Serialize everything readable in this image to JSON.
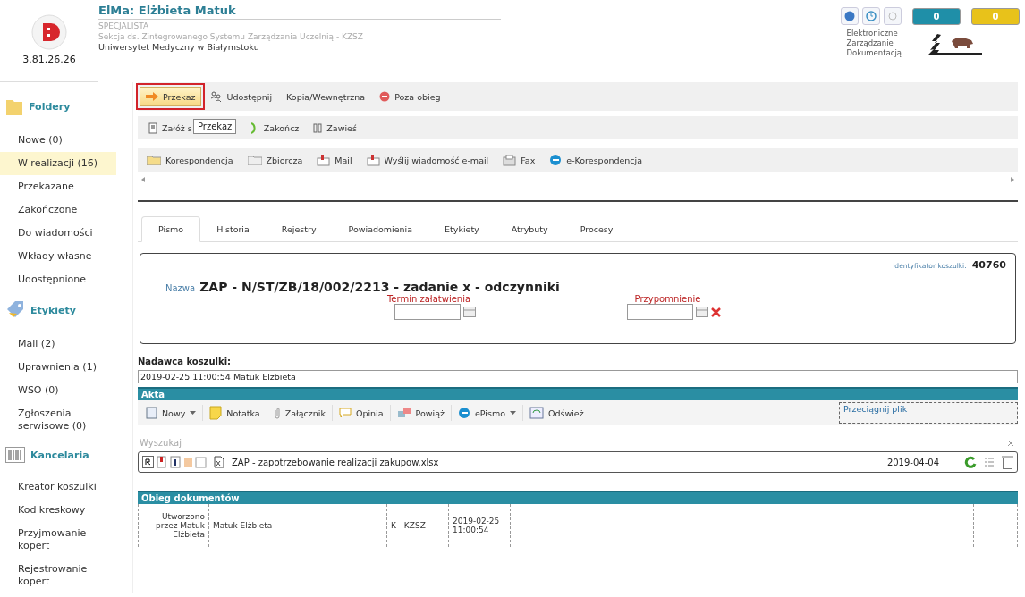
{
  "header": {
    "title": "ElMa: Elżbieta Matuk",
    "role": "SPECJALISTA",
    "department": "Sekcja ds. Zintegrowanego Systemu Zarządzania Uczelnią - KZSZ",
    "university": "Uniwersytet Medyczny w Białymstoku",
    "version": "3.81.26.26",
    "counters": [
      {
        "value": "0",
        "color": "#1f8fa8"
      },
      {
        "value": "0",
        "color": "#e8c21a"
      }
    ],
    "brand_lines": [
      "Elektroniczne",
      "Zarządzanie",
      "Dokumentacją"
    ]
  },
  "sidebar": [
    {
      "title": "Foldery",
      "items": [
        {
          "label": "Nowe (0)",
          "selected": false
        },
        {
          "label": "W realizacji (16)",
          "selected": true
        },
        {
          "label": "Przekazane",
          "selected": false
        },
        {
          "label": "Zakończone",
          "selected": false
        },
        {
          "label": "Do wiadomości",
          "selected": false
        },
        {
          "label": "Wkłady własne",
          "selected": false
        },
        {
          "label": "Udostępnione",
          "selected": false
        }
      ]
    },
    {
      "title": "Etykiety",
      "items": [
        {
          "label": "Mail (2)",
          "selected": false
        },
        {
          "label": "Uprawnienia (1)",
          "selected": false
        },
        {
          "label": "WSO (0)",
          "selected": false
        },
        {
          "label": "Zgłoszenia serwisowe (0)",
          "selected": false
        }
      ]
    },
    {
      "title": "Kancelaria",
      "items": [
        {
          "label": "Kreator koszulki",
          "selected": false
        },
        {
          "label": "Kod kreskowy",
          "selected": false
        },
        {
          "label": "Przyjmowanie kopert",
          "selected": false
        },
        {
          "label": "Rejestrowanie kopert",
          "selected": false
        }
      ]
    }
  ],
  "toolbar_1": [
    {
      "label": "Przekaz",
      "highlighted": true
    },
    {
      "label": "Udostępnij",
      "highlighted": false
    },
    {
      "label": "Kopia/Wewnętrzna",
      "highlighted": false
    },
    {
      "label": "Poza obieg",
      "highlighted": false
    }
  ],
  "toolbar_2": {
    "items": [
      "Załóż s",
      "Zakończ",
      "Zawieś"
    ],
    "tooltip": "Przekaz"
  },
  "toolbar_3": [
    "Korespondencja",
    "Zbiorcza",
    "Mail",
    "Wyślij wiadomość e-mail",
    "Fax",
    "e-Korespondencja"
  ],
  "tabs": [
    {
      "label": "Pismo",
      "selected": true
    },
    {
      "label": "Historia",
      "selected": false
    },
    {
      "label": "Rejestry",
      "selected": false
    },
    {
      "label": "Powiadomienia",
      "selected": false
    },
    {
      "label": "Etykiety",
      "selected": false
    },
    {
      "label": "Atrybuty",
      "selected": false
    },
    {
      "label": "Procesy",
      "selected": false
    }
  ],
  "form": {
    "id_label": "Identyfikator koszulki:",
    "id_value": "40760",
    "name_label": "Nazwa",
    "name_value": "ZAP - N/ST/ZB/18/002/2213 - zadanie x - odczynniki",
    "due_label": "Termin załatwienia",
    "reminder_label": "Przypomnienie"
  },
  "sender": {
    "label": "Nadawca koszulki:",
    "value": "2019-02-25 11:00:54  Matuk Elżbieta"
  },
  "files": {
    "title": "Akta",
    "toolbar": [
      {
        "label": "Nowy",
        "dropdown": true
      },
      {
        "label": "Notatka",
        "dropdown": false
      },
      {
        "label": "Załącznik",
        "dropdown": false
      },
      {
        "label": "Opinia",
        "dropdown": false
      },
      {
        "label": "Powiąż",
        "dropdown": false
      },
      {
        "label": "ePismo",
        "dropdown": true
      },
      {
        "label": "Odśwież",
        "dropdown": false
      }
    ],
    "drop_zone": "Przeciągnij plik",
    "search_placeholder": "Wyszukaj",
    "file_name": "ZAP - zapotrzebowanie realizacji zakupow.xlsx",
    "file_date": "2019-04-04"
  },
  "flow": {
    "title": "Obieg dokumentów",
    "rows": [
      [
        "Utworzono przez Matuk Elżbieta",
        "Matuk Elżbieta",
        "K - KZSZ",
        "2019-02-25 11:00:54"
      ]
    ]
  }
}
